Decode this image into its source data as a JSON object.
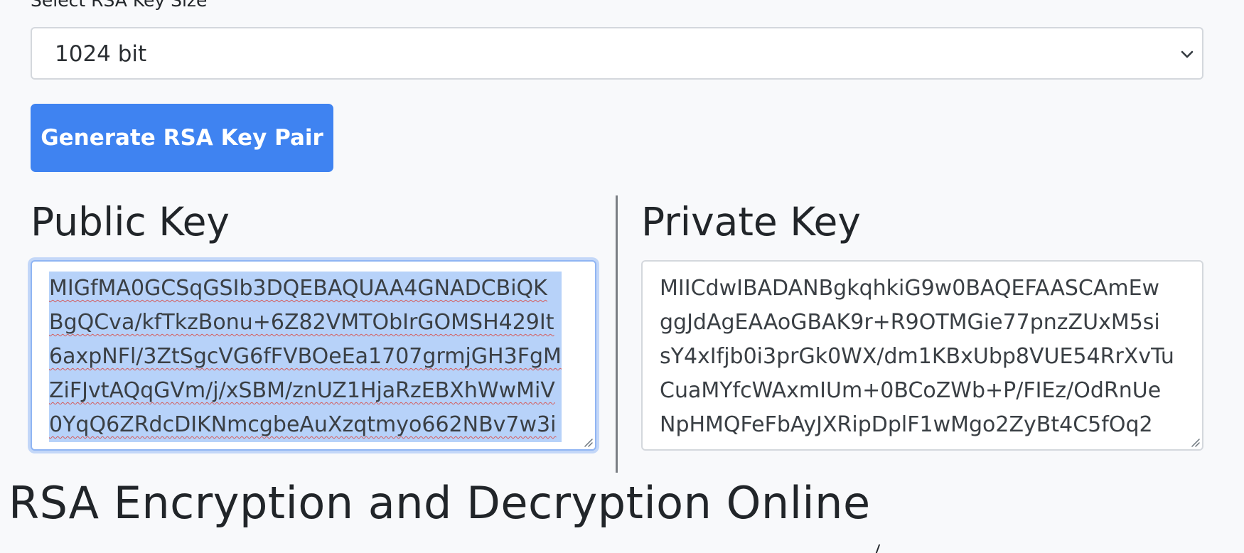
{
  "key_size": {
    "label": "Select RSA Key Size",
    "selected": "1024 bit"
  },
  "generate_button": {
    "label": "Generate RSA Key Pair",
    "color": "#3f83f1"
  },
  "public_key": {
    "title": "Public Key",
    "value": "MIGfMA0GCSqGSIb3DQEBAQUAA4GNADCBiQK\nBgQCva/kfTkzBonu+6Z82VMTObIrGOMSH429It\n6axpNFl/3ZtSgcVG6fFVBOeEa1707grmjGH3FgM\nZiFJvtAQqGVm/j/xSBM/znUZ1HjaRzEBXhWwMiV\n0YqQ6ZRdcDIKNmcgbeAuXzqtmyo662NBv7w3i"
  },
  "private_key": {
    "title": "Private Key",
    "value": "MIICdwIBADANBgkqhkiG9w0BAQEFAASCAmEw\nggJdAgEAAoGBAK9r+R9OTMGie77pnzZUxM5si\nsY4xIfjb0i3prGk0WX/dm1KBxUbp8VUE54RrXvTu\nCuaMYfcWAxmIUm+0BCoZWb+P/FIEz/OdRnUe\nNpHMQFeFbAyJXRipDplF1wMgo2ZyBt4C5fOq2"
  },
  "page": {
    "heading": "RSA Encryption and Decryption Online"
  },
  "icons": {
    "select_arrow": "chevron-down-icon",
    "resize": "resize-grip-icon"
  }
}
